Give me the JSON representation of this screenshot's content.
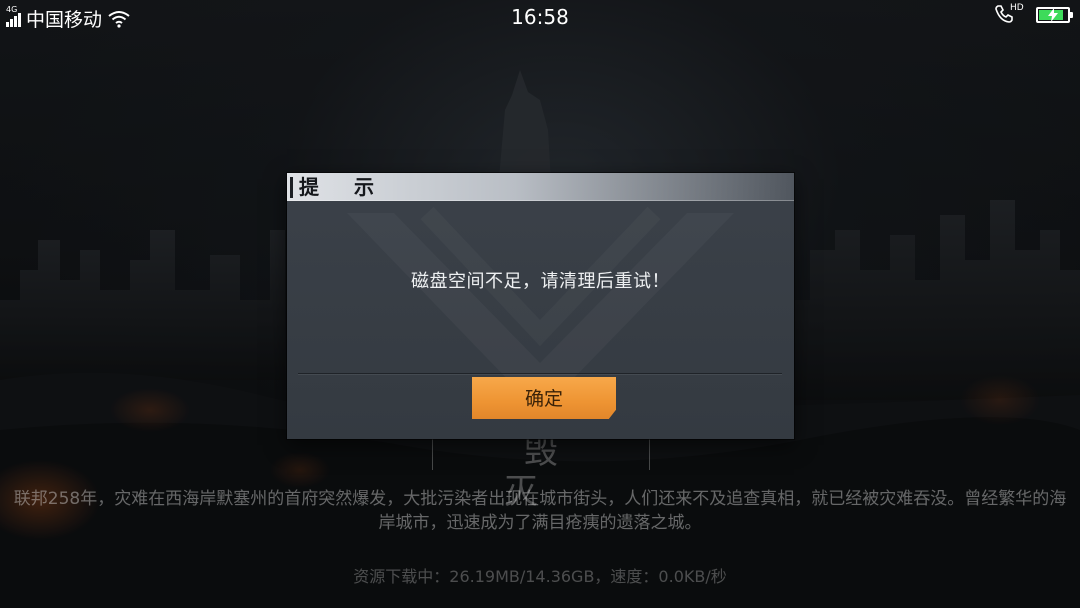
{
  "status_bar": {
    "network_type": "4G",
    "carrier": "中国移动",
    "time": "16:58",
    "call_badge": "HD",
    "battery_level": 0.85,
    "battery_color": "#3ddb5a"
  },
  "background": {
    "chapter_title": "毁 灭",
    "story_text": "联邦258年，灾难在西海岸默塞州的首府突然爆发，大批污染者出现在城市街头，人们还来不及追查真相，就已经被灾难吞没。曾经繁华的海岸城市，迅速成为了满目疮痍的遗落之城。",
    "download_status": "资源下载中：26.19MB/14.36GB，速度：0.0KB/秒"
  },
  "dialog": {
    "title": "提 示",
    "message": "磁盘空间不足，请清理后重试！",
    "confirm_label": "确定",
    "accent_color": "#ee9433"
  }
}
